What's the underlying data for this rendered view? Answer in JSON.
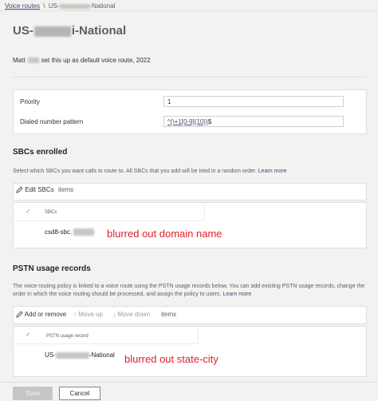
{
  "breadcrumb": {
    "parent": "Voice routes",
    "separator": "\\",
    "current_prefix": "US-",
    "current_suffix": "-National"
  },
  "page": {
    "title_prefix": "US-",
    "title_suffix": "i-National",
    "meta_prefix": "Matt",
    "meta_suffix": "set this up as default voice route, 2022"
  },
  "fields": {
    "priority_label": "Priority",
    "priority_value": "1",
    "pattern_label": "Dialed number pattern",
    "pattern_value_link": "^(\\+1[0-9]{10})",
    "pattern_value_end": "$"
  },
  "sbcs": {
    "heading": "SBCs enrolled",
    "description": "Select which SBCs you want calls to route to. All SBCs that you add will be tried in a random order.",
    "learn_more": "Learn more",
    "edit_label": "Edit SBCs",
    "items_label": "items",
    "column_header": "SBCs",
    "rows": [
      {
        "name": "csd8-sbc."
      }
    ],
    "annotation": "blurred out domain name"
  },
  "pstn": {
    "heading": "PSTN usage records",
    "description": "The voice routing policy is linked to a voice route using the PSTN usage records below. You can add existing PSTN usage records, change the order in which the voice routing should be processed, and assign the policy to users.",
    "learn_more": "Learn more",
    "add_remove_label": "Add or remove",
    "move_up_label": "Move up",
    "move_down_label": "Move down",
    "items_label": "items",
    "column_header": "PSTN usage record",
    "rows": [
      {
        "prefix": "US-",
        "suffix": "-National"
      }
    ],
    "annotation": "blurred out state-city"
  },
  "footer": {
    "save_label": "Save",
    "cancel_label": "Cancel"
  },
  "colors": {
    "accent": "#464775",
    "annotation_red": "#e0202a",
    "background": "#f3f2f1"
  }
}
